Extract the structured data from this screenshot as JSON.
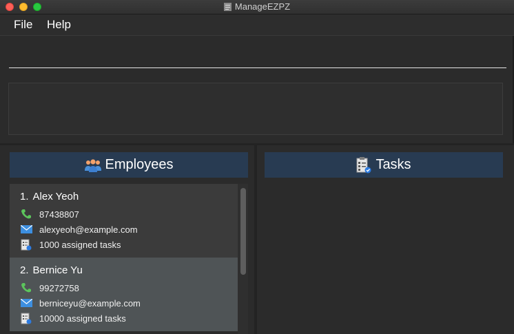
{
  "window": {
    "title": "ManageEZPZ"
  },
  "menubar": {
    "items": [
      "File",
      "Help"
    ]
  },
  "command": {
    "value": ""
  },
  "result": {
    "text": ""
  },
  "employees": {
    "header": "Employees",
    "items": [
      {
        "index": "1.",
        "name": "Alex Yeoh",
        "phone": "87438807",
        "email": "alexyeoh@example.com",
        "tasks": "1000 assigned tasks"
      },
      {
        "index": "2.",
        "name": "Bernice Yu",
        "phone": "99272758",
        "email": "berniceyu@example.com",
        "tasks": "10000 assigned tasks"
      }
    ]
  },
  "tasks": {
    "header": "Tasks"
  },
  "colors": {
    "header_bg": "#283b52",
    "card_bg": "#3b3b3b",
    "card_selected_bg": "#4f5456",
    "phone_icon": "#5cc55c",
    "email_icon": "#3d8fe0"
  },
  "icons": [
    "close-light",
    "minimize-light",
    "zoom-light",
    "people-icon",
    "checklist-icon",
    "phone-icon",
    "mail-icon",
    "task-icon"
  ]
}
